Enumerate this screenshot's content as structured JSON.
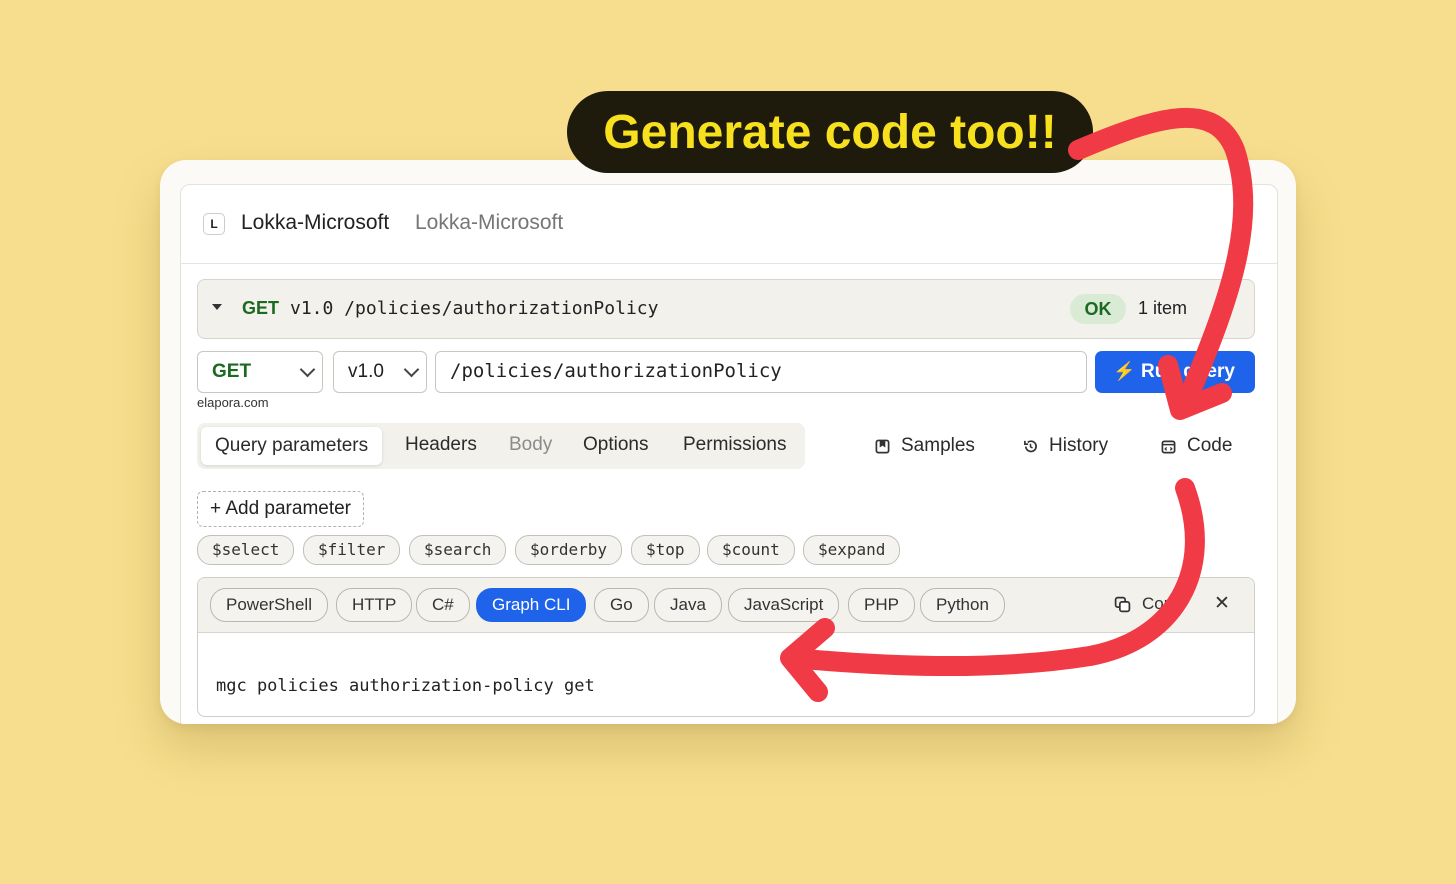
{
  "banner": {
    "text": "Generate code too!!"
  },
  "window": {
    "logo_letter": "L",
    "title": "Lokka-Microsoft",
    "subtitle": "Lokka-Microsoft"
  },
  "request_summary": {
    "method": "GET",
    "path": "v1.0 /policies/authorizationPolicy",
    "status": "OK",
    "count": "1 item"
  },
  "query_bar": {
    "method": "GET",
    "version": "v1.0",
    "url": "/policies/authorizationPolicy",
    "run_label": "Run query",
    "domain": "elapora.com"
  },
  "tabs": [
    "Query parameters",
    "Headers",
    "Body",
    "Options",
    "Permissions"
  ],
  "right_links": {
    "samples": "Samples",
    "history": "History",
    "code": "Code"
  },
  "add_parameter": "+ Add parameter",
  "query_chips": [
    "$select",
    "$filter",
    "$search",
    "$orderby",
    "$top",
    "$count",
    "$expand"
  ],
  "code_panel": {
    "languages": [
      "PowerShell",
      "HTTP",
      "C#",
      "Graph CLI",
      "Go",
      "Java",
      "JavaScript",
      "PHP",
      "Python"
    ],
    "active_language": "Graph CLI",
    "copy_label": "Copy",
    "code": "mgc policies authorization-policy get"
  },
  "colors": {
    "background": "#f7de8e",
    "accent": "#1e63e9",
    "method_green": "#1c6a22",
    "arrow": "#f03a45",
    "banner_text": "#f7e01d"
  },
  "icons": [
    "chevron-down-icon",
    "bolt-icon",
    "samples-icon",
    "history-icon",
    "code-icon",
    "copy-icon",
    "close-icon"
  ]
}
